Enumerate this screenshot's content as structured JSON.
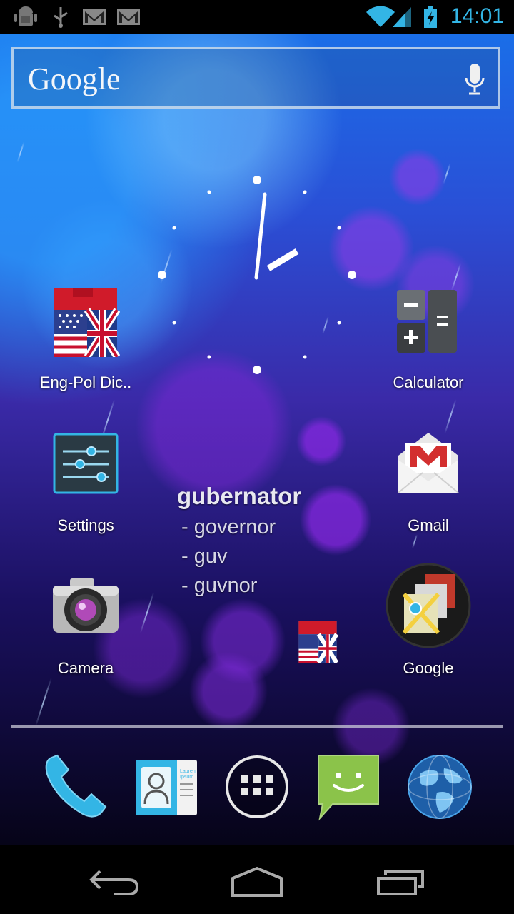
{
  "status_bar": {
    "time": "14:01",
    "left_icons": [
      "android-debug-icon",
      "usb-icon",
      "gmail-notification-icon",
      "gmail-notification-icon"
    ],
    "right_icons": [
      "wifi-icon",
      "cell-signal-icon",
      "battery-charging-icon"
    ],
    "accent_color": "#33b5e5"
  },
  "search": {
    "logo_text": "Google",
    "voice_icon": "microphone-icon"
  },
  "clock_widget": {
    "time": "14:01"
  },
  "apps": {
    "eng_pol": {
      "label": "Eng-Pol Dic..",
      "icon": "flag-dictionary-icon"
    },
    "calculator": {
      "label": "Calculator",
      "icon": "calculator-icon"
    },
    "settings": {
      "label": "Settings",
      "icon": "settings-sliders-icon"
    },
    "gmail": {
      "label": "Gmail",
      "icon": "gmail-envelope-icon"
    },
    "camera": {
      "label": "Camera",
      "icon": "camera-icon"
    },
    "google_folder": {
      "label": "Google",
      "icon": "folder-icon"
    }
  },
  "dictionary_widget": {
    "word": "gubernator",
    "translations": [
      "- governor",
      "- guv",
      "- guvnor"
    ]
  },
  "dock": [
    {
      "name": "phone",
      "icon": "phone-icon"
    },
    {
      "name": "contacts",
      "icon": "contacts-icon",
      "card_text": "Lauren Ipsum"
    },
    {
      "name": "all-apps",
      "icon": "app-drawer-icon"
    },
    {
      "name": "messaging",
      "icon": "messaging-icon"
    },
    {
      "name": "browser",
      "icon": "globe-icon"
    }
  ],
  "navigation": [
    "back-icon",
    "home-icon",
    "recent-apps-icon"
  ]
}
